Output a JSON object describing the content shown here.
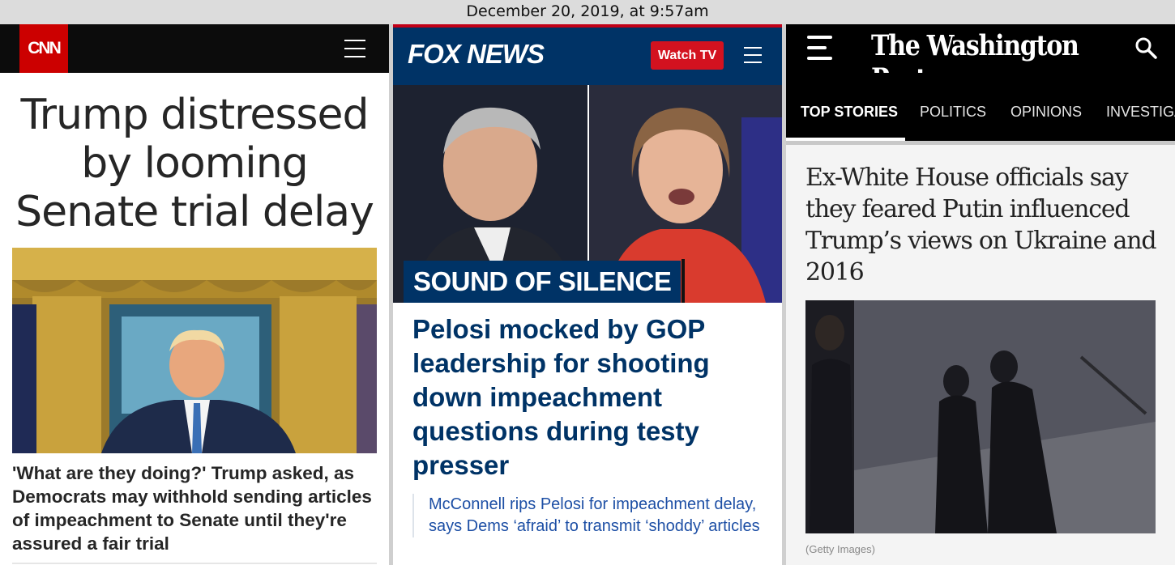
{
  "screenshot": {
    "timestamp": "December 20, 2019, at 9:57am"
  },
  "cnn": {
    "logo_text": "CNN",
    "headline": "Trump distressed by looming Senate trial delay",
    "subhead": "'What are they doing?' Trump asked, as Democrats may withhold sending articles of impeachment to Senate until they're assured a fair trial"
  },
  "fox": {
    "logo_text": "FOX NEWS",
    "watch_label": "Watch TV",
    "kicker": "SOUND OF SILENCE",
    "headline": "Pelosi mocked by GOP leadership for shooting down impeachment questions during testy presser",
    "related": "McConnell rips Pelosi for impeachment delay, says Dems ‘afraid’ to transmit ‘shoddy’ articles"
  },
  "wapo": {
    "logo_text": "The Washington Post",
    "nav": [
      "TOP STORIES",
      "POLITICS",
      "OPINIONS",
      "INVESTIGATIONS"
    ],
    "headline": "Ex-White House officials say they feared Putin influenced Trump’s views on Ukraine and 2016",
    "credit": "(Getty Images)"
  },
  "colors": {
    "cnn_red": "#cc0000",
    "fox_navy": "#003366",
    "fox_red": "#d3121f",
    "fox_link": "#1d4fa5"
  },
  "icons": [
    "menu-icon",
    "search-icon"
  ]
}
